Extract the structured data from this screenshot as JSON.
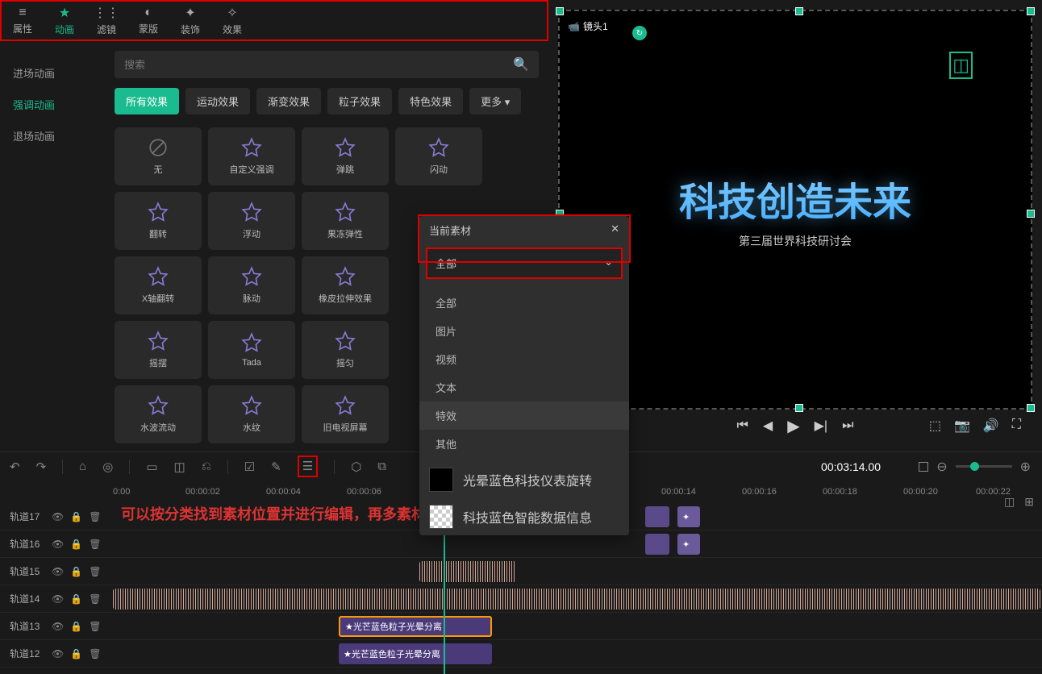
{
  "topTabs": [
    {
      "label": "属性",
      "icon": "≡"
    },
    {
      "label": "动画",
      "icon": "★",
      "active": true
    },
    {
      "label": "滤镜",
      "icon": "⋮⋮"
    },
    {
      "label": "蒙版",
      "icon": "◐"
    },
    {
      "label": "装饰",
      "icon": "✦"
    },
    {
      "label": "效果",
      "icon": "✧"
    }
  ],
  "sideTabs": [
    {
      "label": "进场动画"
    },
    {
      "label": "强调动画",
      "active": true
    },
    {
      "label": "退场动画"
    }
  ],
  "search": {
    "placeholder": "搜索"
  },
  "filters": [
    {
      "label": "所有效果",
      "active": true
    },
    {
      "label": "运动效果"
    },
    {
      "label": "渐变效果"
    },
    {
      "label": "粒子效果"
    },
    {
      "label": "特色效果"
    },
    {
      "label": "更多 ▾"
    }
  ],
  "effects": [
    {
      "label": "无",
      "none": true
    },
    {
      "label": "自定义强调"
    },
    {
      "label": "弹跳"
    },
    {
      "label": "闪动"
    },
    {
      "label": "翻转"
    },
    {
      "label": "浮动"
    },
    {
      "label": "果冻弹性"
    },
    {
      "label": ""
    },
    {
      "label": "X轴翻转"
    },
    {
      "label": "脉动"
    },
    {
      "label": "橡皮拉伸效果"
    },
    {
      "label": ""
    },
    {
      "label": "摇摆"
    },
    {
      "label": "Tada"
    },
    {
      "label": "摇匀"
    },
    {
      "label": ""
    },
    {
      "label": "水波流动"
    },
    {
      "label": "水纹"
    },
    {
      "label": "旧电视屏幕"
    },
    {
      "label": ""
    }
  ],
  "preview": {
    "shotLabel": "镜头1",
    "title": "科技创造未来",
    "subtitle": "第三届世界科技研讨会"
  },
  "popup": {
    "title": "当前素材",
    "selected": "全部",
    "options": [
      "全部",
      "图片",
      "视频",
      "文本",
      "特效",
      "其他"
    ],
    "thumbs": [
      {
        "label": "光晕蓝色科技仪表旋转"
      },
      {
        "label": "科技蓝色智能数据信息"
      }
    ]
  },
  "annotation": "可以按分类找到素材位置并进行编辑，再多素材也不怕，剪辑更高效",
  "timecode": "00:03:14.00",
  "ruler": [
    "0:00",
    "00:00:02",
    "00:00:04",
    "00:00:06",
    "00:00:14",
    "00:00:16",
    "00:00:18",
    "00:00:20",
    "00:00:22"
  ],
  "tracks": [
    {
      "name": "轨道17"
    },
    {
      "name": "轨道16"
    },
    {
      "name": "轨道15"
    },
    {
      "name": "轨道14"
    },
    {
      "name": "轨道13"
    },
    {
      "name": "轨道12"
    }
  ],
  "clipLabels": {
    "fx1": "光芒蓝色粒子光晕分离",
    "fx2": "光芒蓝色粒子光晕分离"
  }
}
